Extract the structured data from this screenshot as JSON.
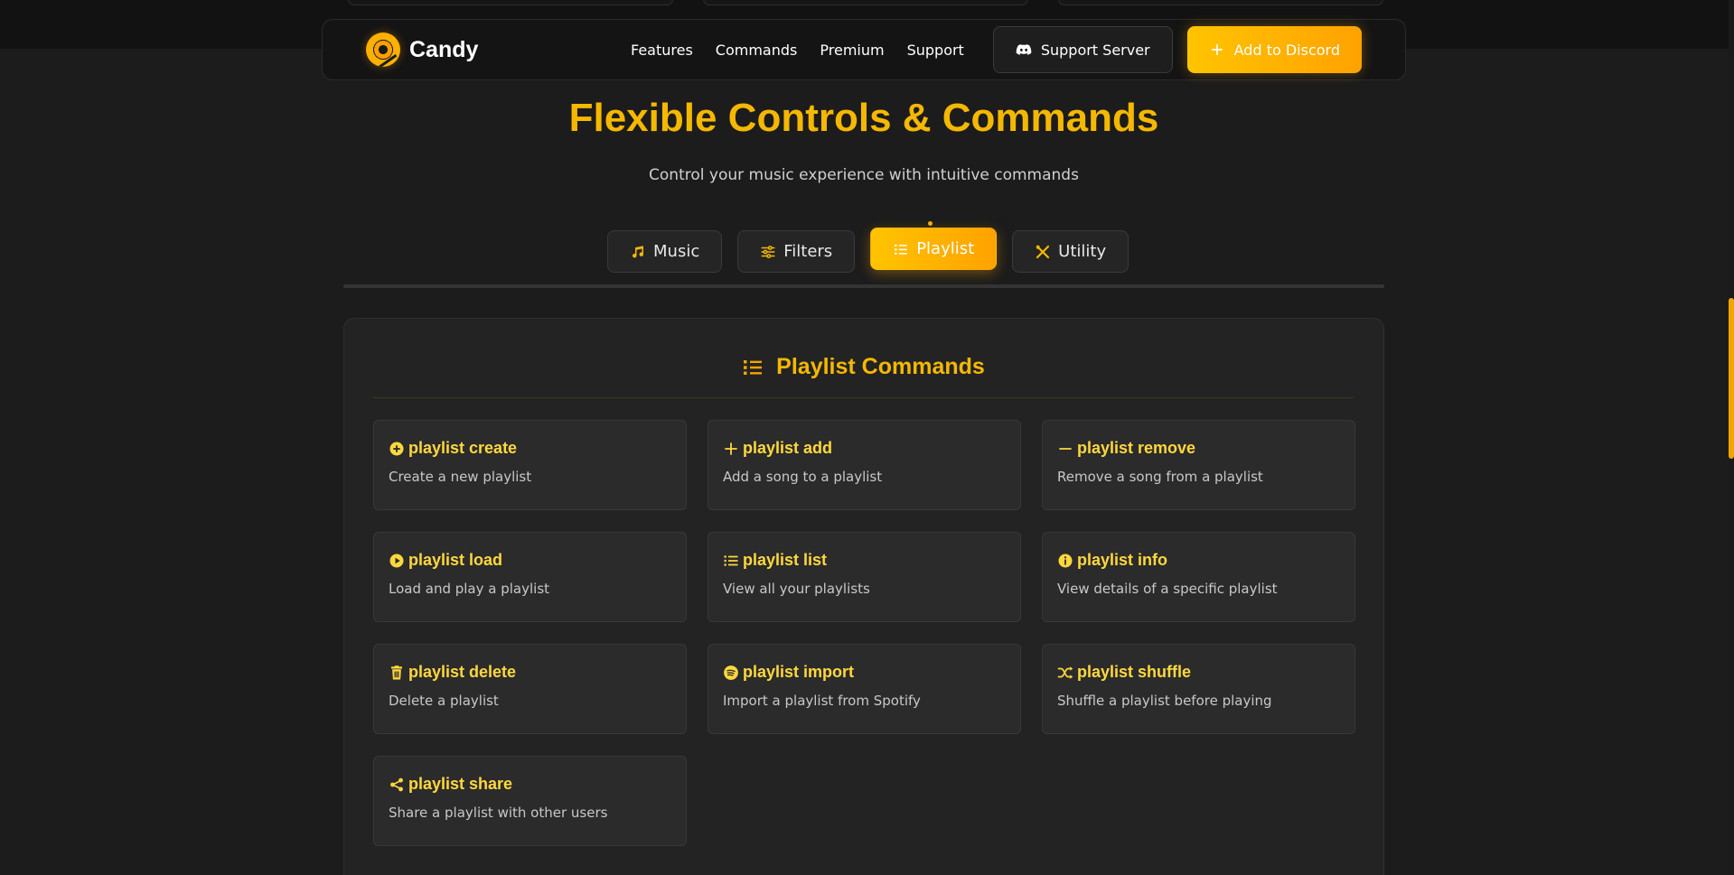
{
  "brand": {
    "name": "Candy"
  },
  "nav": {
    "links": [
      "Features",
      "Commands",
      "Premium",
      "Support"
    ],
    "support_button": "Support Server",
    "add_button": "Add to Discord"
  },
  "hero": {
    "title": "Flexible Controls & Commands",
    "subtitle": "Control your music experience with intuitive commands"
  },
  "tabs": [
    {
      "label": "Music",
      "icon": "music-note-icon",
      "active": false
    },
    {
      "label": "Filters",
      "icon": "sliders-icon",
      "active": false
    },
    {
      "label": "Playlist",
      "icon": "list-icon",
      "active": true
    },
    {
      "label": "Utility",
      "icon": "tools-icon",
      "active": false
    }
  ],
  "panel": {
    "title": "Playlist Commands",
    "icon": "list-icon",
    "commands": [
      {
        "name": "playlist create",
        "desc": "Create a new playlist",
        "icon": "plus-circle-icon"
      },
      {
        "name": "playlist add",
        "desc": "Add a song to a playlist",
        "icon": "plus-icon"
      },
      {
        "name": "playlist remove",
        "desc": "Remove a song from a playlist",
        "icon": "minus-icon"
      },
      {
        "name": "playlist load",
        "desc": "Load and play a playlist",
        "icon": "play-circle-icon"
      },
      {
        "name": "playlist list",
        "desc": "View all your playlists",
        "icon": "list-icon"
      },
      {
        "name": "playlist info",
        "desc": "View details of a specific playlist",
        "icon": "info-circle-icon"
      },
      {
        "name": "playlist delete",
        "desc": "Delete a playlist",
        "icon": "trash-icon"
      },
      {
        "name": "playlist import",
        "desc": "Import a playlist from Spotify",
        "icon": "spotify-icon"
      },
      {
        "name": "playlist shuffle",
        "desc": "Shuffle a playlist before playing",
        "icon": "shuffle-icon"
      },
      {
        "name": "playlist share",
        "desc": "Share a playlist with other users",
        "icon": "share-icon"
      }
    ]
  },
  "colors": {
    "accent": "#f5b800",
    "accent_gradient_start": "#ffc400",
    "accent_gradient_end": "#ffa200",
    "background": "#1c1c1c",
    "card_title": "#ffd83d"
  }
}
